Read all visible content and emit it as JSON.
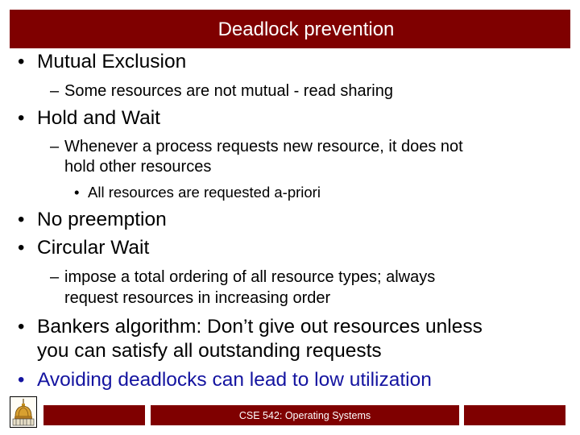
{
  "slide": {
    "title": "Deadlock prevention",
    "footer": "CSE 542: Operating Systems",
    "colors": {
      "brand": "#7f0000",
      "text": "#000000",
      "highlight": "#1414a0"
    },
    "bullets": [
      {
        "level": 1,
        "marker": "•",
        "text": "Mutual Exclusion"
      },
      {
        "level": 2,
        "marker": "–",
        "text": "Some resources are not mutual - read sharing"
      },
      {
        "level": 1,
        "marker": "•",
        "text": "Hold and Wait"
      },
      {
        "level": 2,
        "marker": "–",
        "text": "Whenever a process requests new resource, it does not",
        "continuation": "hold other resources"
      },
      {
        "level": 3,
        "marker": "•",
        "text": "All resources are requested a-priori"
      },
      {
        "level": 1,
        "marker": "•",
        "text": "No preemption"
      },
      {
        "level": 1,
        "marker": "•",
        "text": "Circular Wait"
      },
      {
        "level": 2,
        "marker": "–",
        "text": "impose a total ordering of all resource types; always",
        "continuation": "request resources in increasing order"
      },
      {
        "level": 1,
        "marker": "•",
        "text": "Bankers algorithm: Don’t give out resources unless",
        "continuation": "you can satisfy all outstanding requests"
      },
      {
        "level": 1,
        "marker": "•",
        "text": "Avoiding deadlocks can lead to low utilization",
        "highlight": true
      }
    ],
    "logo_icon": "golden-dome-icon"
  }
}
